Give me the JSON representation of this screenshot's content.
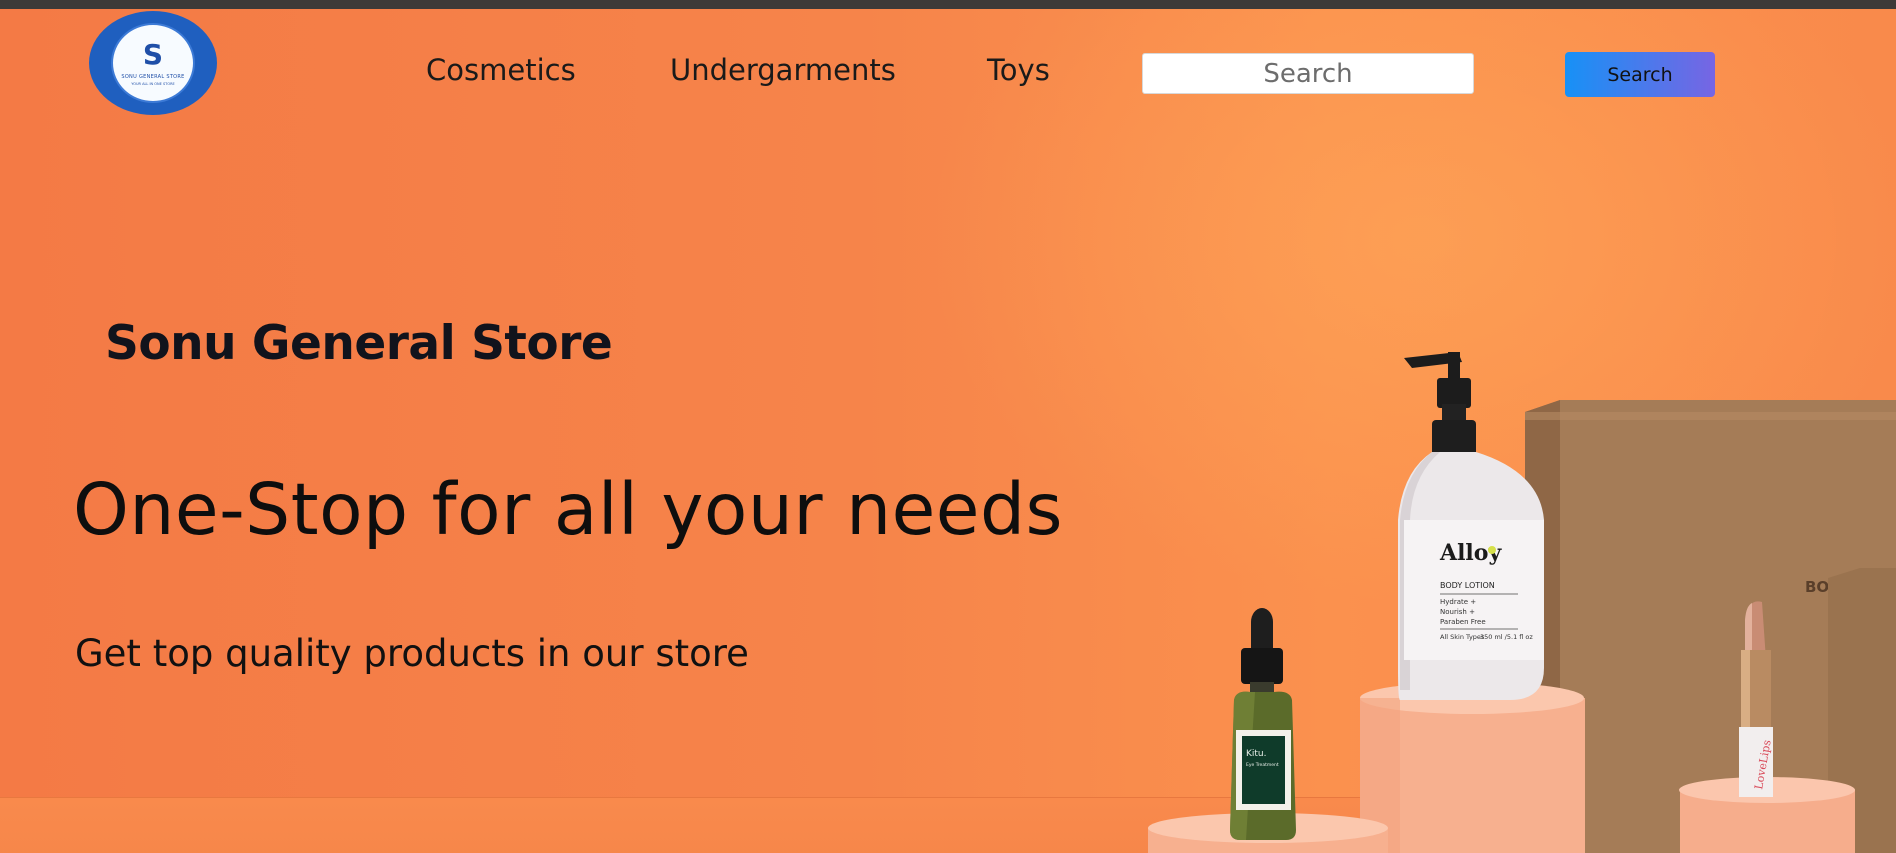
{
  "logo": {
    "letter": "S",
    "name": "SONU GENERAL STORE",
    "sub": "YOUR ALL IN ONE STORE"
  },
  "nav": {
    "links": [
      {
        "label": "Cosmetics"
      },
      {
        "label": "Undergarments"
      },
      {
        "label": "Toys"
      }
    ],
    "search_placeholder": "Search",
    "search_button": "Search"
  },
  "hero": {
    "store_title": "Sonu General Store",
    "tagline": "One-Stop for all your needs",
    "subtagline": "Get top quality products in our store"
  },
  "products": {
    "lotion_brand": "Alloy",
    "lotion_type": "BODY LOTION",
    "lotion_lines": [
      "Hydrate +",
      "Nourish +",
      "Paraben Free"
    ],
    "lotion_skin": "All Skin Types",
    "lotion_volume": "350 ml /5.1 fl oz",
    "serum_brand": "Kitu.",
    "serum_type": "Eye Treatment",
    "lipstick_brand": "LoveLips",
    "box_text": "BOX"
  },
  "colors": {
    "background": "#f58a4b",
    "topbar": "#3d3a38",
    "logo_blue": "#1f5fbf",
    "button_gradient_start": "#1791f6",
    "button_gradient_end": "#7765e3"
  }
}
